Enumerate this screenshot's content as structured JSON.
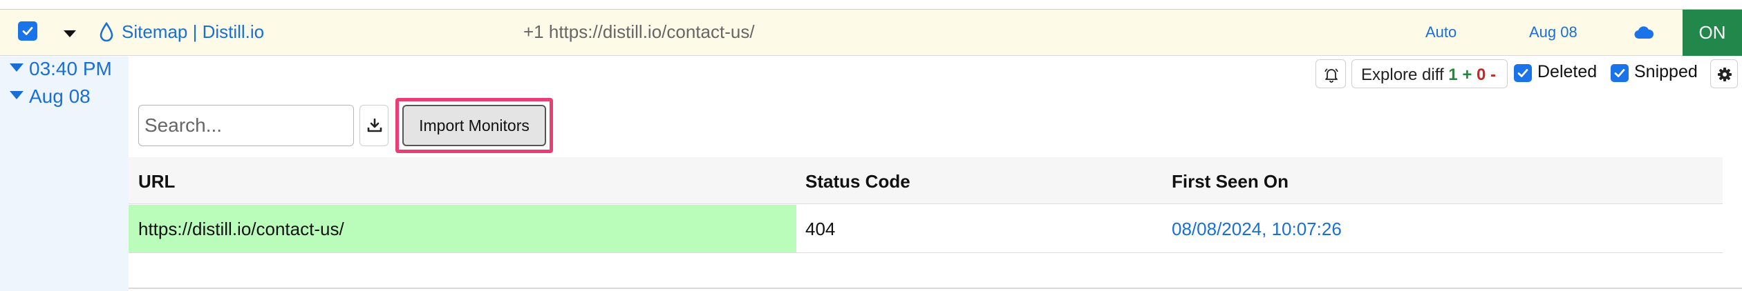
{
  "monitor": {
    "name": "Sitemap | Distill.io",
    "url_summary": "+1 https://distill.io/contact-us/",
    "schedule": "Auto",
    "last_change": "Aug 08",
    "toggle_label": "ON",
    "checked": true
  },
  "timeline": {
    "entries": [
      {
        "label": "03:40 PM"
      },
      {
        "label": "Aug 08"
      }
    ]
  },
  "toolbar": {
    "explore_diff_label": "Explore diff",
    "added_count": "1",
    "plus_sign": "+",
    "removed_count": "0",
    "minus_sign": "-",
    "deleted_label": "Deleted",
    "snipped_label": "Snipped",
    "deleted_checked": true,
    "snipped_checked": true
  },
  "search": {
    "placeholder": "Search...",
    "value": ""
  },
  "import_button_label": "Import Monitors",
  "table": {
    "columns": [
      "URL",
      "Status Code",
      "First Seen On"
    ],
    "rows": [
      {
        "url": "https://distill.io/contact-us/",
        "status_code": "404",
        "first_seen": "08/08/2024, 10:07:26"
      }
    ]
  },
  "colors": {
    "accent": "#1a6fd6",
    "on_toggle": "#22874a",
    "highlight": "#e83e74",
    "new_row": "#bafdba",
    "row_bg": "#fdfbe8"
  },
  "icons": {
    "row_icon": "water-drop-icon",
    "cloud": "cloud-icon",
    "bell": "bell-icon",
    "download": "download-icon",
    "settings": "gear-icon"
  }
}
